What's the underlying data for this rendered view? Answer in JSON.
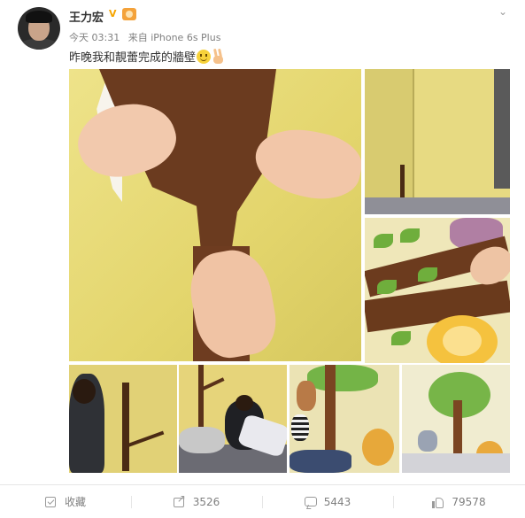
{
  "post": {
    "username": "王力宏",
    "verified_mark": "V",
    "time": "今天 03:31",
    "source": "来自 iPhone 6s Plus",
    "text": "昨晚我和靚蕾完成的牆壁"
  },
  "actions": {
    "favorite_label": "收藏",
    "share_count": "3526",
    "comment_count": "5443",
    "like_count": "79578"
  },
  "icons": {
    "menu": "chevron-down-icon",
    "favorite": "favorite-icon",
    "share": "share-icon",
    "comment": "comment-icon",
    "like": "like-icon"
  },
  "colors": {
    "text_primary": "#333333",
    "text_secondary": "#808080",
    "verified_gold": "#f6a500"
  }
}
